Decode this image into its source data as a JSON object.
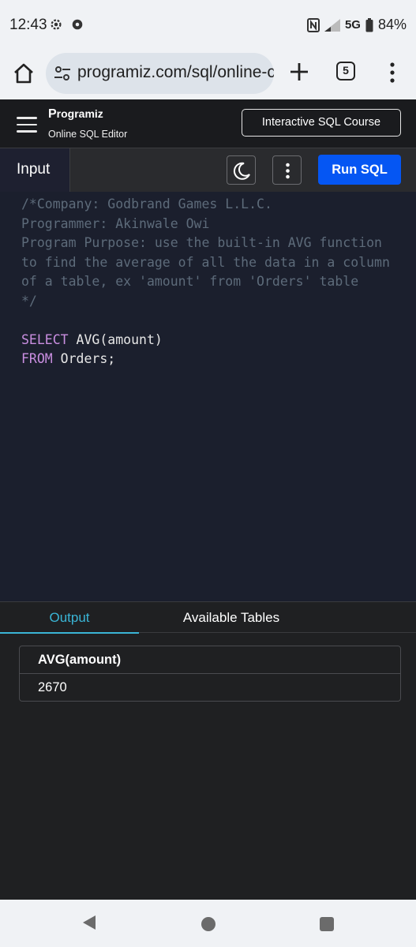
{
  "status": {
    "time": "12:43",
    "network": "5G",
    "battery": "84%"
  },
  "browser": {
    "url": "programiz.com/sql/online-c",
    "tab_count": "5"
  },
  "header": {
    "logo_text": "rogramiz",
    "logo_mark": "P",
    "subtitle": "Online SQL Editor",
    "course_button": "Interactive SQL Course"
  },
  "toolbar": {
    "input_tab": "Input",
    "run_button": "Run SQL"
  },
  "editor": {
    "lines": [
      {
        "text": "/*Company: Godbrand Games L.L.C.",
        "type": "comment"
      },
      {
        "text": "Programmer: Akinwale Owi",
        "type": "comment"
      },
      {
        "text": "Program Purpose: use the built-in AVG function",
        "type": "comment"
      },
      {
        "text": "to find the average of all the data in a column",
        "type": "comment"
      },
      {
        "text": "of a table, ex 'amount' from 'Orders' table",
        "type": "comment"
      },
      {
        "text": "*/",
        "type": "comment"
      },
      {
        "text": "",
        "type": "blank"
      },
      {
        "keyword": "SELECT",
        "rest": " AVG(amount)",
        "type": "code"
      },
      {
        "keyword": "FROM",
        "rest": " Orders;",
        "type": "code"
      }
    ]
  },
  "output": {
    "tabs": [
      "Output",
      "Available Tables"
    ],
    "table": {
      "header": "AVG(amount)",
      "value": "2670"
    }
  },
  "colors": {
    "accent": "#3ab5d6",
    "run_button": "#0556f3",
    "keyword": "#c98ee0",
    "comment": "#5d6b7a"
  }
}
